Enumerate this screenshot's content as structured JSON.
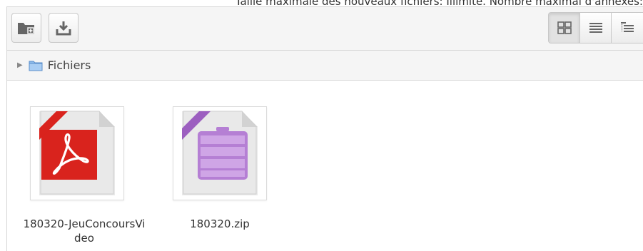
{
  "header": {
    "info_text": "Taille maximale des nouveaux fichiers: Illimité. Nombre maximal d'annexes:"
  },
  "toolbar": {
    "buttons": [
      {
        "icon": "create-folder-icon"
      },
      {
        "icon": "download-icon"
      }
    ],
    "view_modes": [
      {
        "icon": "grid-view-icon",
        "active": true
      },
      {
        "icon": "list-view-icon",
        "active": false
      },
      {
        "icon": "tree-view-icon",
        "active": false
      }
    ]
  },
  "path": {
    "root_label": "Fichiers"
  },
  "files": [
    {
      "name": "180320-JeuConcoursVideo",
      "type": "pdf",
      "accent": "#e0201b"
    },
    {
      "name": "180320.zip",
      "type": "zip",
      "accent": "#9b59b6"
    }
  ],
  "colors": {
    "pdf_red": "#d9231d",
    "zip_purple": "#a86fc6",
    "folder_blue": "#7fb0e6"
  }
}
